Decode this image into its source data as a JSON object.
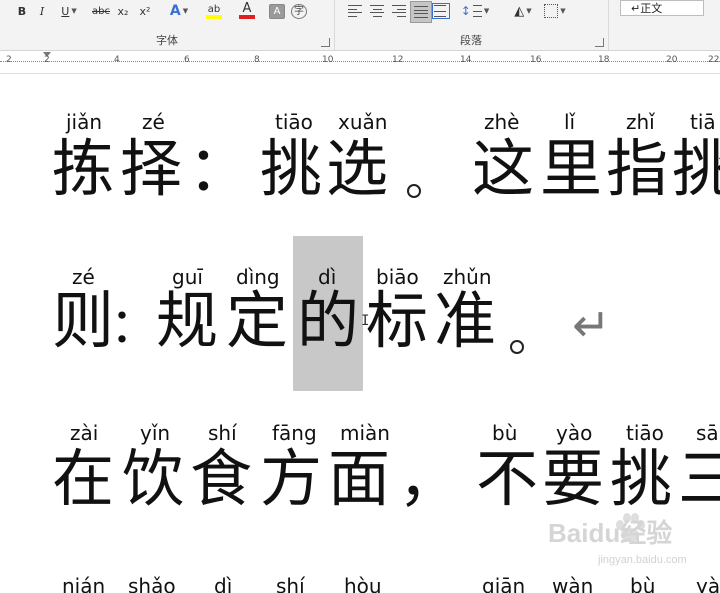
{
  "ribbon": {
    "font_group_label": "字体",
    "paragraph_group_label": "段落",
    "style_current": "↵正文",
    "tools": {
      "bold": "B",
      "italic": "I",
      "underline": "U",
      "strikethrough": "abc",
      "subscript": "x₂",
      "superscript": "x²",
      "text_effects": "A",
      "highlight": "ab",
      "font_color": "A",
      "char_shading": "A",
      "enclose": "字"
    },
    "colors": {
      "highlight": "#ffff00",
      "font_color": "#e02020"
    }
  },
  "ruler": {
    "numbers": [
      "2",
      "2",
      "4",
      "6",
      "8",
      "10",
      "12",
      "14",
      "16",
      "18",
      "20",
      "22"
    ]
  },
  "document": {
    "lines": [
      {
        "pinyin": [
          "jiǎn",
          "zé",
          "tiāo",
          "xuǎn",
          "zhè",
          "lǐ",
          "zhǐ",
          "tiā"
        ],
        "hanzi": [
          "拣",
          "择",
          "：",
          "挑",
          "选",
          "。",
          "这",
          "里",
          "指",
          "挑"
        ]
      },
      {
        "pinyin": [
          "zé",
          "guī",
          "dìng",
          "dì",
          "biāo",
          "zhǔn"
        ],
        "hanzi": [
          "则",
          "：",
          "规",
          "定",
          "的",
          "标",
          "准",
          "。"
        ]
      },
      {
        "pinyin": [
          "zài",
          "yǐn",
          "shí",
          "fāng",
          "miàn",
          "bù",
          "yào",
          "tiāo",
          "sā"
        ],
        "hanzi": [
          "在",
          "饮",
          "食",
          "方",
          "面",
          "，",
          "不",
          "要",
          "挑",
          "三"
        ]
      },
      {
        "pinyin": [
          "nián",
          "shǎo",
          "dì",
          "shí",
          "hòu",
          "qiān",
          "wàn",
          "bù",
          "yà"
        ]
      }
    ],
    "watermark": "Baidu经验",
    "watermark_url": "jingyan.baidu.com"
  }
}
